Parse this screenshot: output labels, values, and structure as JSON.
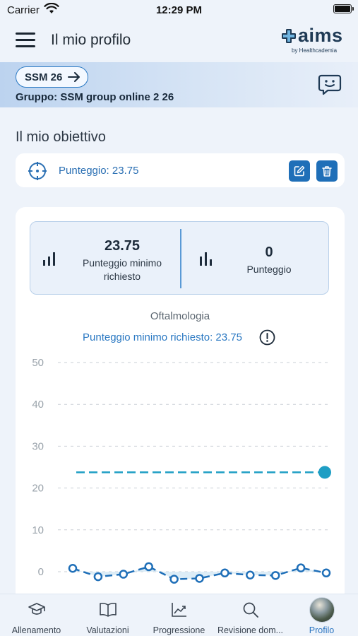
{
  "status_bar": {
    "carrier": "Carrier",
    "time": "12:29 PM"
  },
  "header": {
    "title": "Il mio profilo",
    "logo_text": "aims",
    "logo_byline": "by Healthcademia"
  },
  "group": {
    "chip_label": "SSM 26",
    "group_text": "Gruppo: SSM group online 2 26"
  },
  "goal_section": {
    "title": "Il mio obiettivo",
    "goal_label": "Punteggio: 23.75"
  },
  "stats": {
    "min_required_value": "23.75",
    "min_required_label": "Punteggio minimo richiesto",
    "score_value": "0",
    "score_label": "Punteggio"
  },
  "chart_header": {
    "title": "Oftalmologia",
    "subtitle": "Punteggio minimo richiesto: 23.75"
  },
  "chart_data": {
    "type": "line",
    "y_ticks": [
      "50",
      "40",
      "30",
      "20",
      "10",
      "0"
    ],
    "ylim": [
      0,
      50
    ],
    "grid": true,
    "threshold": 23.75,
    "series": [
      {
        "values": [
          0.8,
          -1.2,
          -0.6,
          1.2,
          -1.8,
          -1.6,
          -0.3,
          -0.8,
          -0.9,
          0.9,
          -0.3
        ]
      }
    ]
  },
  "colors": {
    "accent": "#1f6fb8",
    "threshold": "#1e9ec4",
    "series": "#1f6fb8"
  },
  "tabs": [
    {
      "label": "Allenamento",
      "icon": "graduation-cap-icon"
    },
    {
      "label": "Valutazioni",
      "icon": "book-icon"
    },
    {
      "label": "Progressione",
      "icon": "trend-chart-icon"
    },
    {
      "label": "Revisione dom...",
      "icon": "search-icon"
    },
    {
      "label": "Profilo",
      "icon": "avatar"
    }
  ]
}
